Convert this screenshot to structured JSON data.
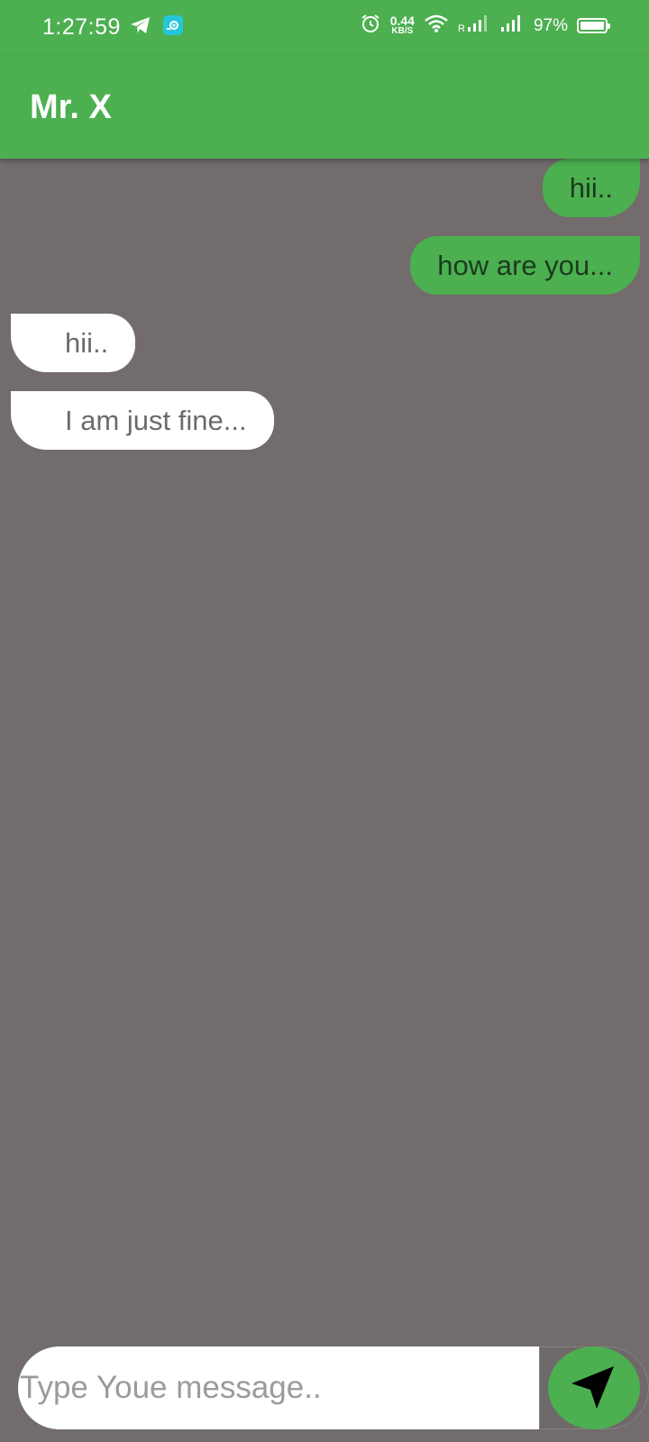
{
  "status_bar": {
    "time": "1:27:59",
    "net_speed_value": "0.44",
    "net_speed_unit": "KB/S",
    "battery_percent": "97%",
    "left_icons": [
      "telegram-icon",
      "app-notification-icon"
    ],
    "right_icons": [
      "alarm-icon",
      "wifi-icon",
      "signal-roaming-icon",
      "signal-icon",
      "battery-icon"
    ]
  },
  "app_bar": {
    "title": "Mr. X"
  },
  "messages": [
    {
      "direction": "sent",
      "text": "hii.."
    },
    {
      "direction": "sent",
      "text": "how are you..."
    },
    {
      "direction": "received",
      "text": "hii.."
    },
    {
      "direction": "received",
      "text": "I am just fine..."
    }
  ],
  "composer": {
    "placeholder": "Type Youe message..",
    "value": "",
    "send_icon": "send-icon"
  },
  "colors": {
    "accent": "#4caf50",
    "background": "#726c6c",
    "received_bubble": "#ffffff"
  }
}
